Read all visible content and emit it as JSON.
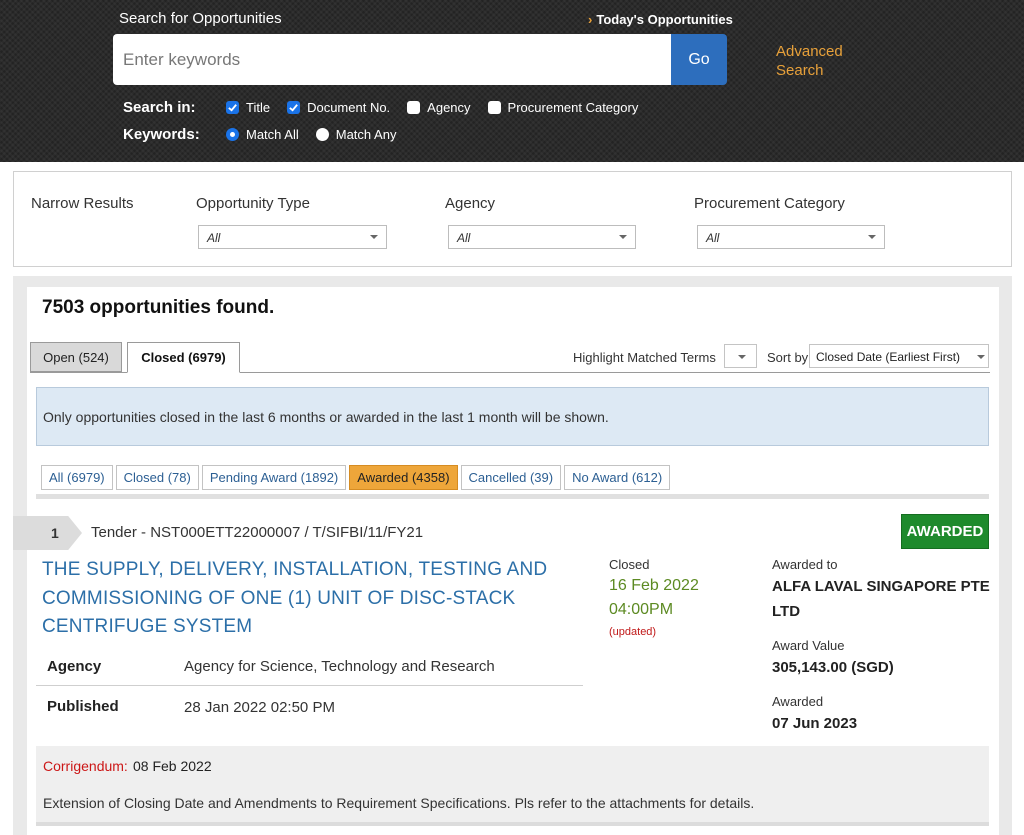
{
  "header": {
    "search_label": "Search for Opportunities",
    "todays_link": "Today's Opportunities",
    "search_placeholder": "Enter keywords",
    "go_label": "Go",
    "advanced_search": "Advanced Search",
    "search_in_label": "Search in:",
    "search_in_options": [
      {
        "label": "Title",
        "checked": true
      },
      {
        "label": "Document No.",
        "checked": true
      },
      {
        "label": "Agency",
        "checked": false
      },
      {
        "label": "Procurement Category",
        "checked": false
      }
    ],
    "keywords_label": "Keywords:",
    "keyword_options": [
      {
        "label": "Match All",
        "selected": true
      },
      {
        "label": "Match Any",
        "selected": false
      }
    ]
  },
  "filters": {
    "title": "Narrow Results",
    "opportunity_type": {
      "label": "Opportunity Type",
      "value": "All"
    },
    "agency": {
      "label": "Agency",
      "value": "All"
    },
    "procurement_category": {
      "label": "Procurement Category",
      "value": "All"
    }
  },
  "results": {
    "found_text": "7503 opportunities found.",
    "tabs": [
      {
        "label": "Open (524)",
        "active": false
      },
      {
        "label": "Closed (6979)",
        "active": true
      }
    ],
    "highlight_label": "Highlight Matched Terms",
    "sort_label": "Sort by",
    "sort_value": "Closed Date (Earliest First)",
    "info_message": "Only opportunities closed in the last 6 months or awarded in the last 1 month will be shown.",
    "status_tabs": [
      {
        "label": "All (6979)",
        "active": false
      },
      {
        "label": "Closed (78)",
        "active": false
      },
      {
        "label": "Pending Award (1892)",
        "active": false
      },
      {
        "label": "Awarded (4358)",
        "active": true
      },
      {
        "label": "Cancelled (39)",
        "active": false
      },
      {
        "label": "No Award (612)",
        "active": false
      }
    ]
  },
  "item": {
    "number": "1",
    "reference": "Tender - NST000ETT22000007 / T/SIFBI/11/FY21",
    "status_badge": "AWARDED",
    "title_lines": [
      "THE SUPPLY, DELIVERY, INSTALLATION, TESTING AND",
      "COMMISSIONING OF ONE (1) UNIT OF DISC-STACK",
      "CENTRIFUGE SYSTEM"
    ],
    "agency_label": "Agency",
    "agency_value": "Agency for Science, Technology and Research",
    "published_label": "Published",
    "published_value": "28 Jan 2022 02:50 PM",
    "closed_label": "Closed",
    "closed_date": "16 Feb 2022",
    "closed_time": "04:00PM",
    "updated_note": "(updated)",
    "awarded_to_label": "Awarded to",
    "awarded_to_lines": [
      "ALFA LAVAL SINGAPORE PTE",
      "LTD"
    ],
    "award_value_label": "Award Value",
    "award_value": "305,143.00 (SGD)",
    "awarded_label": "Awarded",
    "awarded_date": "07 Jun 2023",
    "corrigendum_label": "Corrigendum:",
    "corrigendum_date": "08 Feb 2022",
    "corrigendum_text": "Extension of Closing Date and Amendments to Requirement Specifications. Pls refer to the attachments for details."
  },
  "colors": {
    "accent_blue": "#2d6ebd",
    "link_blue": "#2c6fa8",
    "orange": "#e8a13a",
    "awarded_green": "#1e8a2c",
    "date_green": "#5c8a22",
    "alert_red": "#cc1717"
  },
  "icons": [
    "checkbox-checked-icon",
    "chevron-right-icon",
    "dropdown-caret-icon"
  ]
}
